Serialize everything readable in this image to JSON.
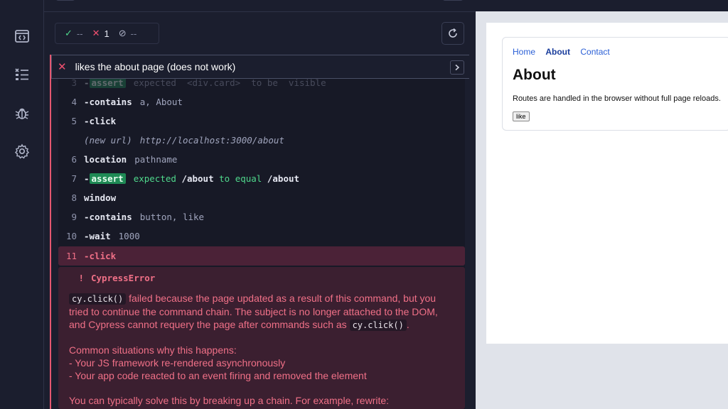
{
  "stats": {
    "passed": "--",
    "failed": "1",
    "pending": "--"
  },
  "test": {
    "title": "likes the about page (does not work)"
  },
  "commands": [
    {
      "num": "3",
      "name": "assert",
      "message": "expected  <div.card>  to be  visible"
    },
    {
      "num": "4",
      "name": "contains",
      "message": "a, About"
    },
    {
      "num": "5",
      "name": "click",
      "message": ""
    },
    {
      "num": "",
      "name": "(new url)",
      "message": "http://localhost:3000/about"
    },
    {
      "num": "6",
      "name": "location",
      "message": "pathname"
    },
    {
      "num": "7",
      "name": "assert",
      "message_expected": "expected",
      "message_value": "/about",
      "message_op": "to equal",
      "message_value2": "/about"
    },
    {
      "num": "8",
      "name": "window",
      "message": ""
    },
    {
      "num": "9",
      "name": "contains",
      "message": "button, like"
    },
    {
      "num": "10",
      "name": "wait",
      "message": "1000"
    },
    {
      "num": "11",
      "name": "click",
      "message": ""
    }
  ],
  "error": {
    "marker": "!",
    "name": "CypressError",
    "code1": "cy.click()",
    "text1": "failed because the page updated as a result of this command, but you tried to continue the command chain. The subject is no longer attached to the DOM, and Cypress cannot requery the page after commands such as",
    "code2": "cy.click()",
    "text2": ".",
    "para2_title": "Common situations why this happens:",
    "bullet1": "- Your JS framework re-rendered asynchronously",
    "bullet2": "- Your app code reacted to an event firing and removed the element",
    "para3": "You can typically solve this by breaking up a chain. For example, rewrite:"
  },
  "app": {
    "nav": [
      "Home",
      "About",
      "Contact"
    ],
    "heading": "About",
    "text": "Routes are handled in the browser without full page reloads.",
    "button": "like"
  },
  "colors": {
    "fail": "#f05070",
    "pass": "#4fd88c",
    "accent_link": "#2a5fd6"
  }
}
